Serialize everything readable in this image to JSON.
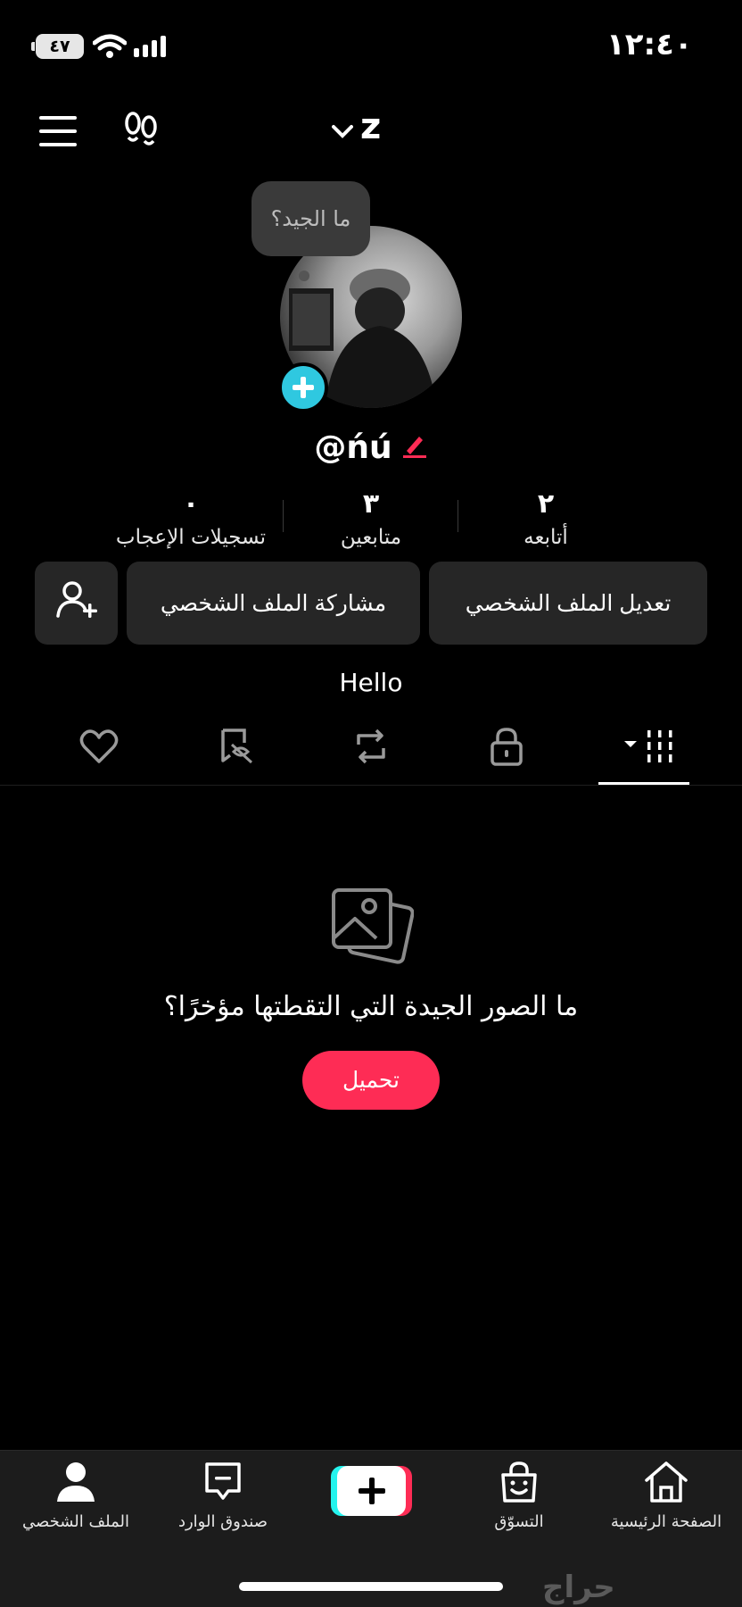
{
  "status_bar": {
    "time": "١٢:٤٠",
    "battery": "٤٧"
  },
  "header": {
    "account_letter": "z"
  },
  "profile": {
    "bubble_text": "ما الجيد؟",
    "username": "@ńú",
    "stats": [
      {
        "value": "٢",
        "label": "أتابعه"
      },
      {
        "value": "٣",
        "label": "متابعين"
      },
      {
        "value": "٠",
        "label": "تسجيلات الإعجاب"
      }
    ],
    "edit_profile_label": "تعديل الملف الشخصي",
    "share_profile_label": "مشاركة الملف الشخصي",
    "bio": "Hello"
  },
  "tabs": [
    "grid-icon",
    "lock-icon",
    "repost-icon",
    "hidden-likes-icon",
    "heart-icon"
  ],
  "empty_state": {
    "text": "ما الصور الجيدة التي التقطتها مؤخرًا؟",
    "upload_label": "تحميل"
  },
  "bottom_nav": {
    "home": "الصفحة الرئيسية",
    "shop": "التسوّق",
    "inbox": "صندوق الوارد",
    "profile": "الملف الشخصي"
  },
  "watermark": "حراج",
  "colors": {
    "accent_pink": "#fe2c55",
    "accent_cyan": "#25f4ee",
    "avatar_plus": "#2fc8e0",
    "button_bg": "#262626"
  }
}
